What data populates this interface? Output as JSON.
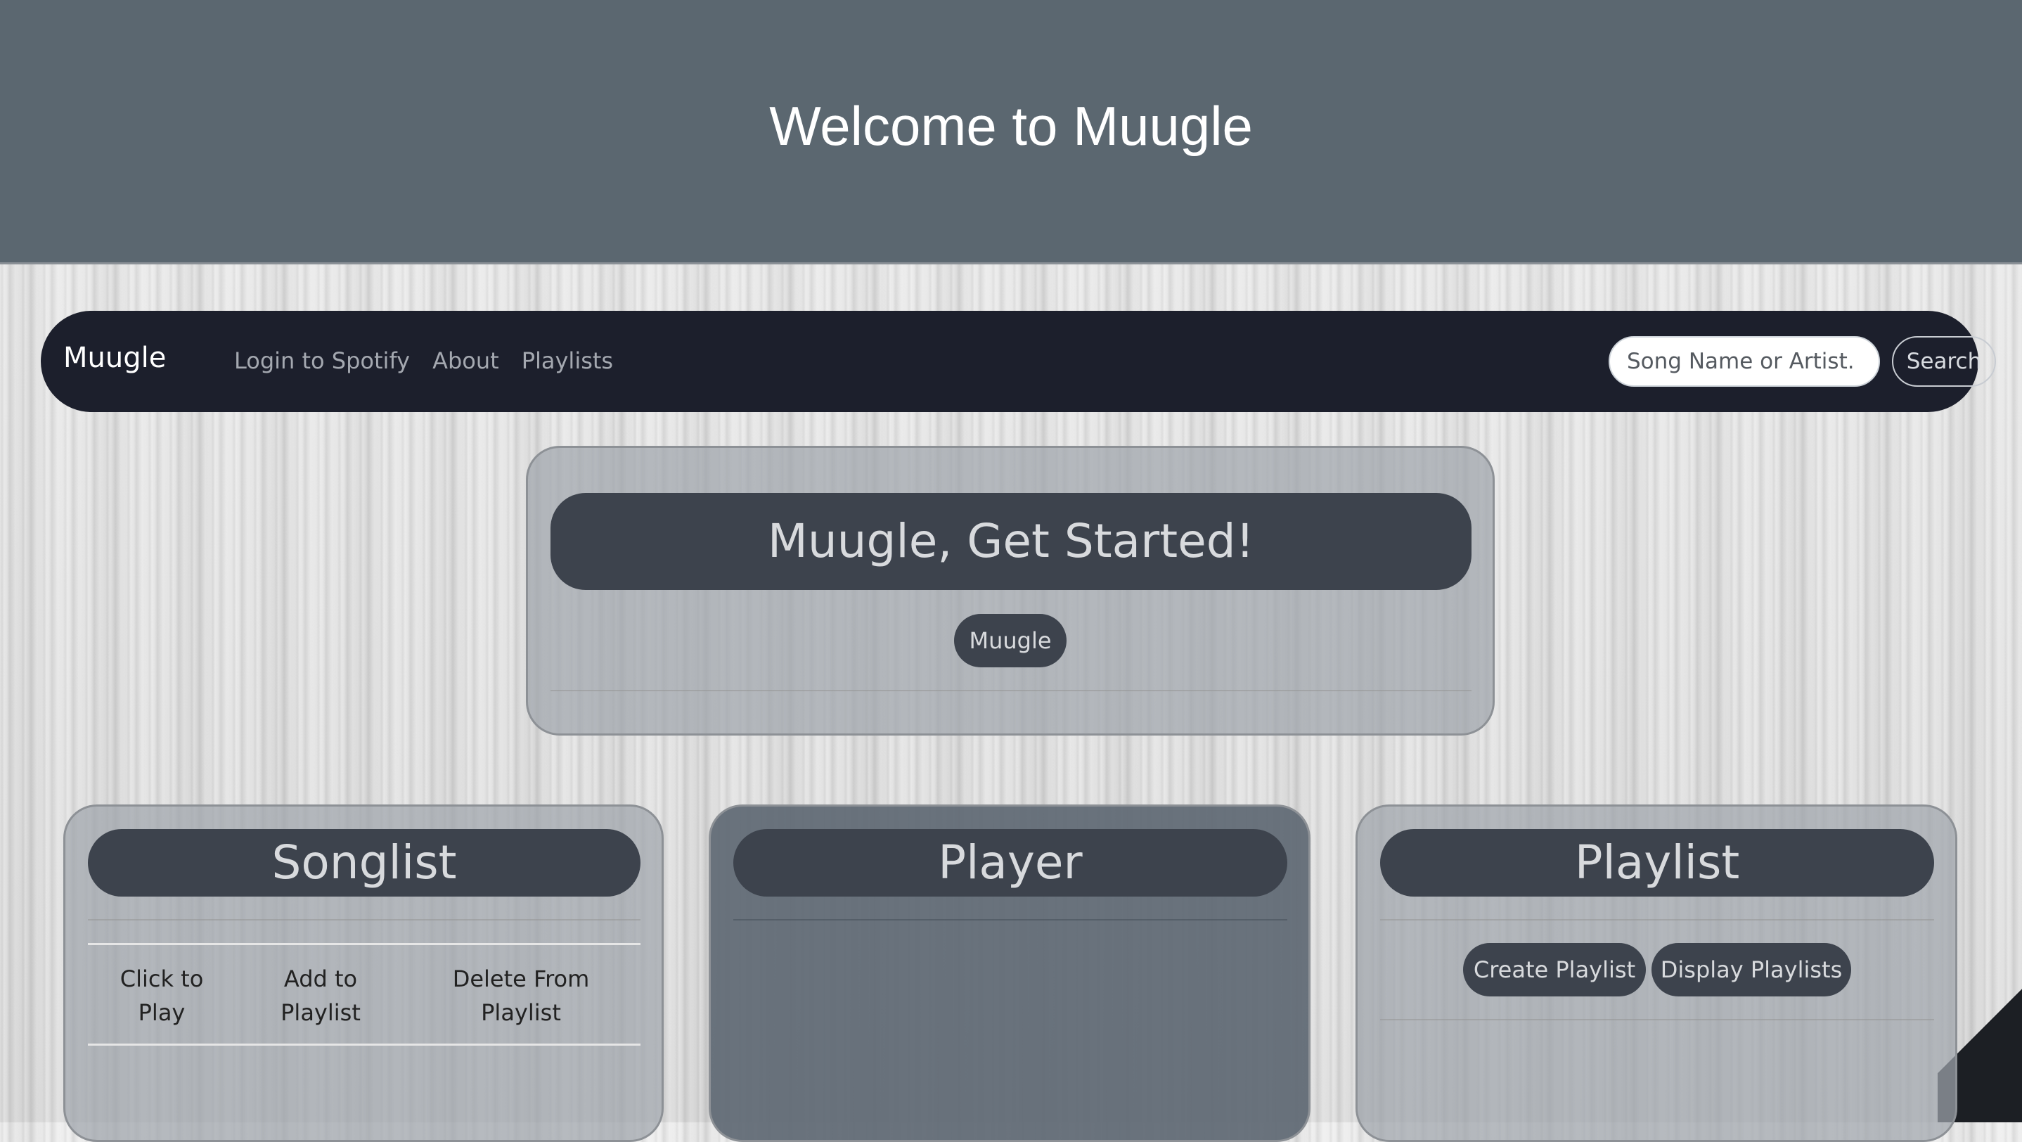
{
  "header": {
    "title": "Welcome to Muugle"
  },
  "navbar": {
    "brand": "Muugle",
    "links": [
      {
        "label": "Login to Spotify"
      },
      {
        "label": "About"
      },
      {
        "label": "Playlists"
      }
    ],
    "search": {
      "placeholder": "Song Name or Artist.",
      "value": "",
      "button_label": "Search"
    }
  },
  "get_started": {
    "title": "Muugle, Get Started!",
    "button_label": "Muugle"
  },
  "songlist": {
    "title": "Songlist",
    "columns": [
      "Click to Play",
      "Add to Playlist",
      "Delete From Playlist"
    ]
  },
  "player": {
    "title": "Player"
  },
  "playlist": {
    "title": "Playlist",
    "create_label": "Create Playlist",
    "display_label": "Display Playlists"
  },
  "colors": {
    "banner": "#5b6770",
    "navbar": "#1c1f2c",
    "card_header": "#3d434d",
    "player_card": "#626c76"
  }
}
